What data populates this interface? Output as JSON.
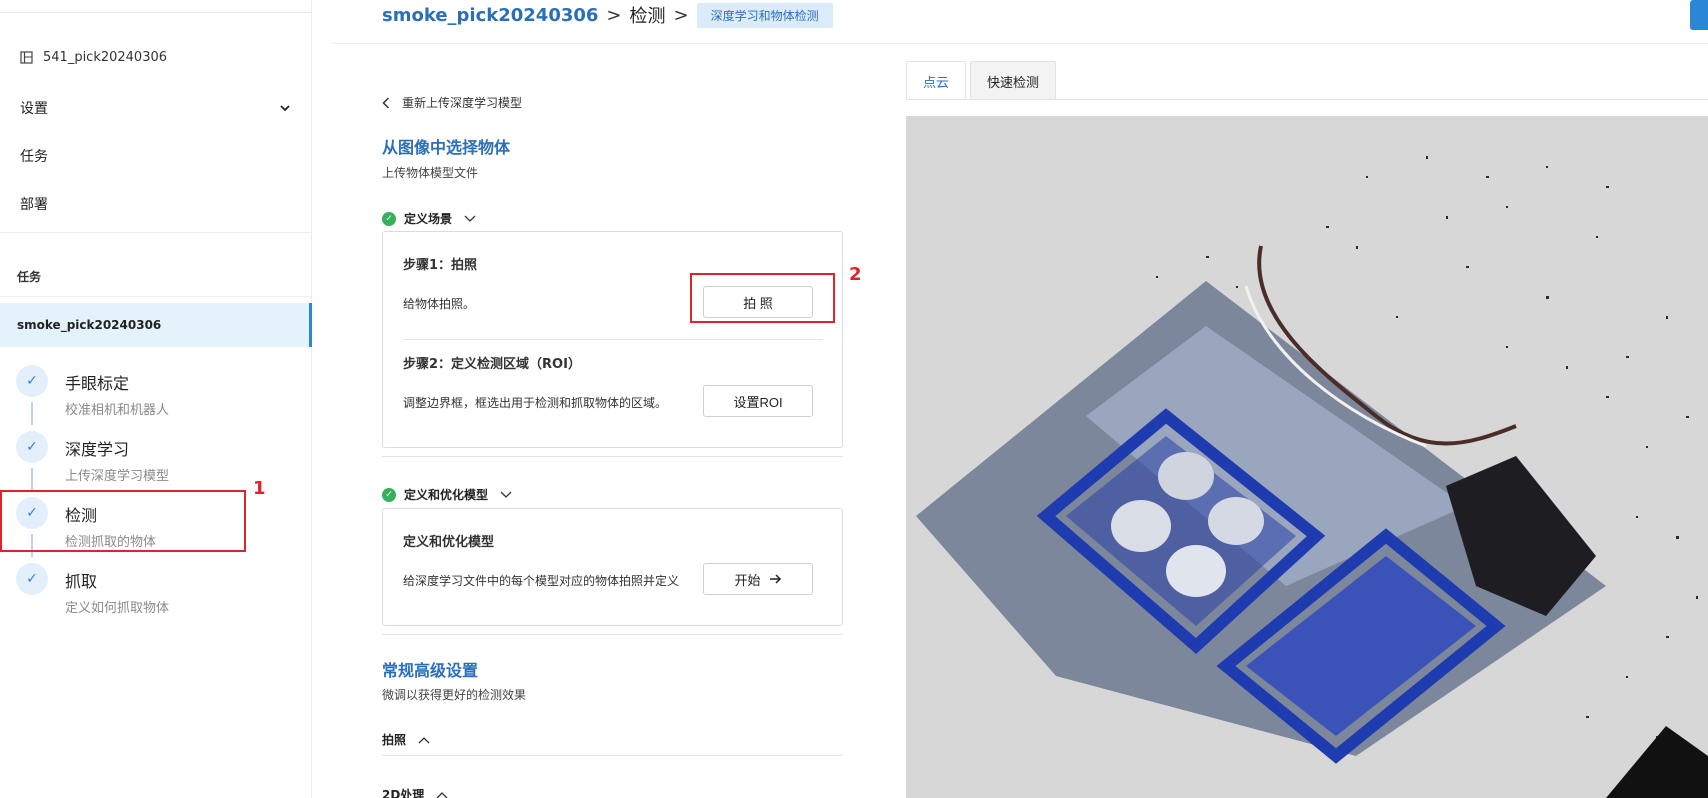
{
  "sidebar": {
    "project_name": "541_pick20240306",
    "menu": {
      "settings": "设置",
      "tasks": "任务",
      "deploy": "部署"
    },
    "section_title": "任务",
    "active_task": "smoke_pick20240306",
    "steps": [
      {
        "title": "手眼标定",
        "sub": "校准相机和机器人"
      },
      {
        "title": "深度学习",
        "sub": "上传深度学习模型"
      },
      {
        "title": "检测",
        "sub": "检测抓取的物体"
      },
      {
        "title": "抓取",
        "sub": "定义如何抓取物体"
      }
    ]
  },
  "annotations": {
    "one": "1",
    "two": "2"
  },
  "header": {
    "project": "smoke_pick20240306",
    "sep": ">",
    "current": "检测",
    "tag": "深度学习和物体检测"
  },
  "main": {
    "back_label": "重新上传深度学习模型",
    "select_title": "从图像中选择物体",
    "select_sub": "上传物体模型文件",
    "scene": {
      "title": "定义场景",
      "step1_title": "步骤1：拍照",
      "step1_desc": "给物体拍照。",
      "step1_btn": "拍 照",
      "step2_title": "步骤2：定义检测区域（ROI）",
      "step2_desc": "调整边界框，框选出用于检测和抓取物体的区域。",
      "step2_btn": "设置ROI"
    },
    "model": {
      "title": "定义和优化模型",
      "card_title": "定义和优化模型",
      "card_desc": "给深度学习文件中的每个模型对应的物体拍照并定义",
      "btn": "开始"
    },
    "advanced": {
      "title": "常规高级设置",
      "sub": "微调以获得更好的检测效果",
      "capture": "拍照",
      "processing_2d": "2D处理"
    }
  },
  "viewer": {
    "tabs": [
      "点云",
      "快速检测"
    ],
    "colors": {
      "background": "#d7d7d7",
      "accent": "#2c86d6",
      "success": "#34b15a",
      "annotation": "#e0232b"
    }
  }
}
